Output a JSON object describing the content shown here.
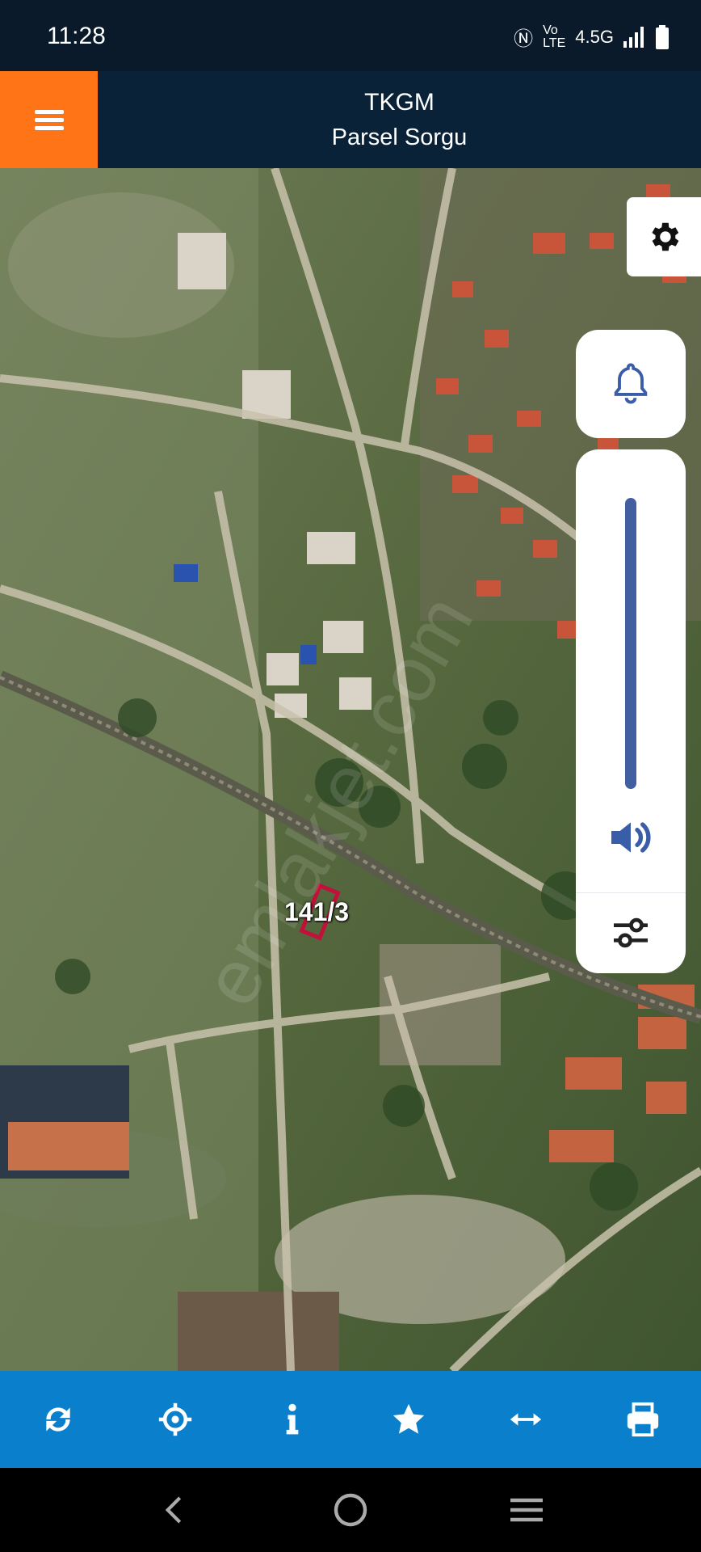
{
  "status": {
    "time": "11:28",
    "network": "4.5G",
    "icons": [
      "nfc-icon",
      "volte-icon",
      "signal-icon",
      "battery-icon"
    ]
  },
  "header": {
    "title": "TKGM",
    "subtitle": "Parsel Sorgu",
    "menu_color": "#ff7417",
    "bg_color": "#0a2238"
  },
  "map": {
    "parcel_label": "141/3",
    "watermark": "emlakjet.com"
  },
  "side_controls": [
    "gear-icon",
    "bell-icon",
    "volume-icon",
    "equalizer-icon"
  ],
  "toolbar": {
    "bg_color": "#0a7fcb",
    "items": [
      "refresh-icon",
      "locate-icon",
      "info-icon",
      "star-icon",
      "measure-icon",
      "print-icon"
    ]
  },
  "navbar": {
    "items": [
      "back-icon",
      "home-icon",
      "recents-icon"
    ]
  }
}
